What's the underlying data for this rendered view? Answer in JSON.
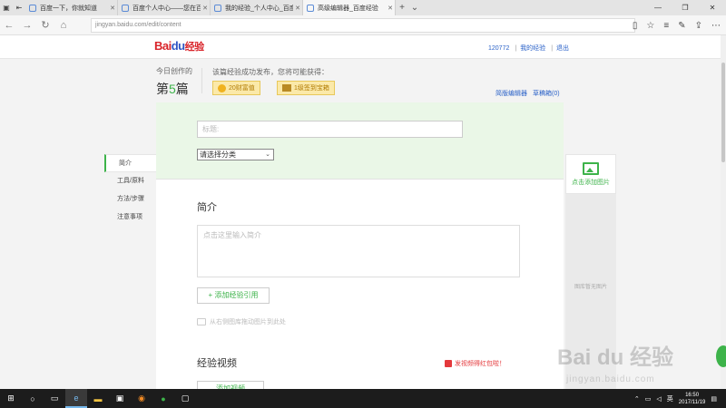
{
  "browser": {
    "tabs": [
      {
        "label": "百度一下，你就知道",
        "active": false
      },
      {
        "label": "百度个人中心——您在百度!",
        "active": false
      },
      {
        "label": "我的经验_个人中心_百度经验",
        "active": false
      },
      {
        "label": "高级编辑器_百度经验",
        "active": true
      }
    ],
    "url": "jingyan.baidu.com/edit/content"
  },
  "header": {
    "logo": {
      "bai": "Bai",
      "du": "du",
      "jy": "经验"
    },
    "user_id": "120772",
    "my_exp": "我的经验",
    "logout": "退出"
  },
  "stats": {
    "today_label": "今日创作的",
    "count_prefix": "第",
    "count_num": "5",
    "count_suffix": "篇",
    "reward_title": "该篇经验成功发布，您将可能获得：",
    "reward1": "20财富值",
    "reward2": "1级签到宝箱"
  },
  "editor_links": {
    "simple": "简版编辑器",
    "drafts": "草稿箱(0)"
  },
  "leftnav": {
    "items": [
      {
        "label": "简介",
        "active": true
      },
      {
        "label": "工具/原料",
        "active": false
      },
      {
        "label": "方法/步骤",
        "active": false
      },
      {
        "label": "注意事项",
        "active": false
      }
    ]
  },
  "form": {
    "title_placeholder": "标题:",
    "category_selected": "请选择分类",
    "intro_heading": "简介",
    "intro_placeholder": "点击这里输入简介",
    "add_reference": "+ 添加经验引用",
    "drag_tip": "从右侧图库拖动图片到此处",
    "video_heading": "经验视频",
    "video_promo": "发视频得红包啦！",
    "add_video": "添加视频"
  },
  "gallery": {
    "add_label": "点击添加图片",
    "empty_label": "图库暂无图片"
  },
  "watermark": {
    "main": "Bai du 经验",
    "sub": "jingyan.baidu.com"
  },
  "taskbar": {
    "time": "16:50",
    "date": "2017/11/19",
    "lang": "英"
  }
}
